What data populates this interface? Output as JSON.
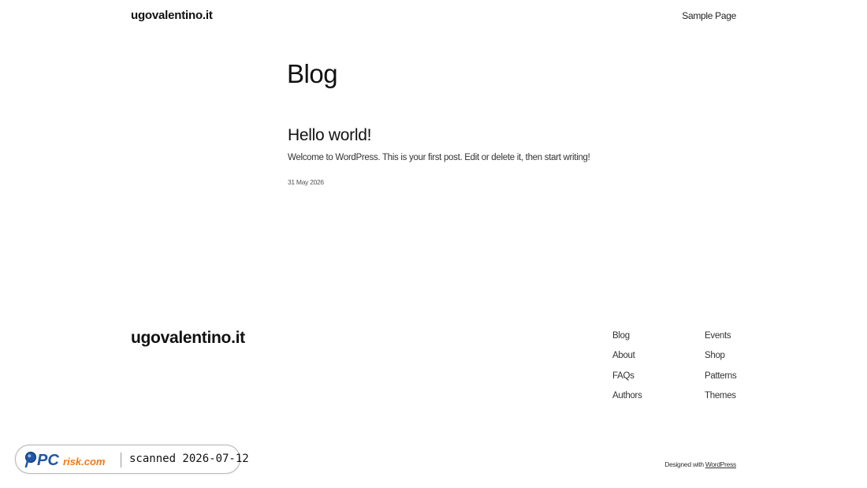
{
  "header": {
    "site_title": "ugovalentino.it",
    "nav": {
      "sample_page": "Sample Page"
    }
  },
  "main": {
    "page_title": "Blog",
    "post": {
      "title": "Hello world!",
      "excerpt": "Welcome to WordPress. This is your first post. Edit or delete it, then start writing!",
      "date": "31 May 2026"
    }
  },
  "footer": {
    "site_title": "ugovalentino.it",
    "nav_col1": [
      "Blog",
      "About",
      "FAQs",
      "Authors"
    ],
    "nav_col2": [
      "Events",
      "Shop",
      "Patterns",
      "Themes"
    ],
    "credit_prefix": "Designed with",
    "credit_link": "WordPress"
  },
  "badge": {
    "logo_text": "PCrisk.com",
    "scanned_text": "scanned 2026-07-12",
    "colors": {
      "logo_blue": "#1f56a8",
      "logo_orange": "#f07a1a"
    }
  }
}
